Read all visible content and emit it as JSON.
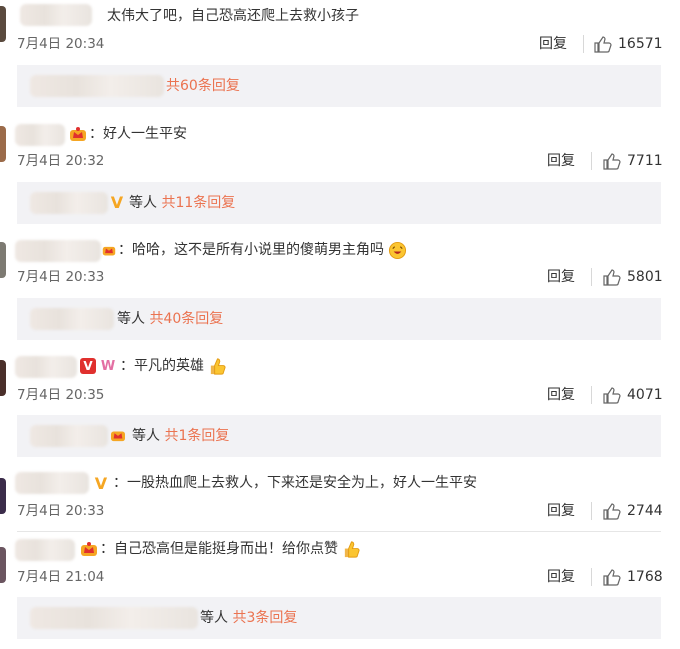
{
  "comments": [
    {
      "text": "太伟大了吧，自己恐高还爬上去救小孩子",
      "time": "7月4日 20:34",
      "reply_label": "回复",
      "likes": "16571",
      "replies_suffix": "",
      "replies_count": "共60条回复"
    },
    {
      "text": "：好人一生平安",
      "time": "7月4日 20:32",
      "reply_label": "回复",
      "likes": "7711",
      "replies_suffix": "等人",
      "replies_count": "共11条回复"
    },
    {
      "text": "：哈哈，这不是所有小说里的傻萌男主角吗",
      "time": "7月4日 20:33",
      "reply_label": "回复",
      "likes": "5801",
      "replies_suffix": "等人",
      "replies_count": "共40条回复"
    },
    {
      "text": "：平凡的英雄",
      "time": "7月4日 20:35",
      "reply_label": "回复",
      "likes": "4071",
      "replies_suffix": "等人",
      "replies_count": "共1条回复"
    },
    {
      "text": "：一股热血爬上去救人，下来还是安全为上，好人一生平安",
      "time": "7月4日 20:33",
      "reply_label": "回复",
      "likes": "2744"
    },
    {
      "text": "：自己恐高但是能挺身而出！给你点赞",
      "time": "7月4日 21:04",
      "reply_label": "回复",
      "likes": "1768",
      "replies_suffix": "等人",
      "replies_count": "共3条回复"
    }
  ],
  "badges": {
    "v_label": "V",
    "w_label": "W"
  },
  "colors": {
    "link": "#eb7350",
    "vip_gold": "#f5a623",
    "reply_bg": "#f2f2f5"
  }
}
